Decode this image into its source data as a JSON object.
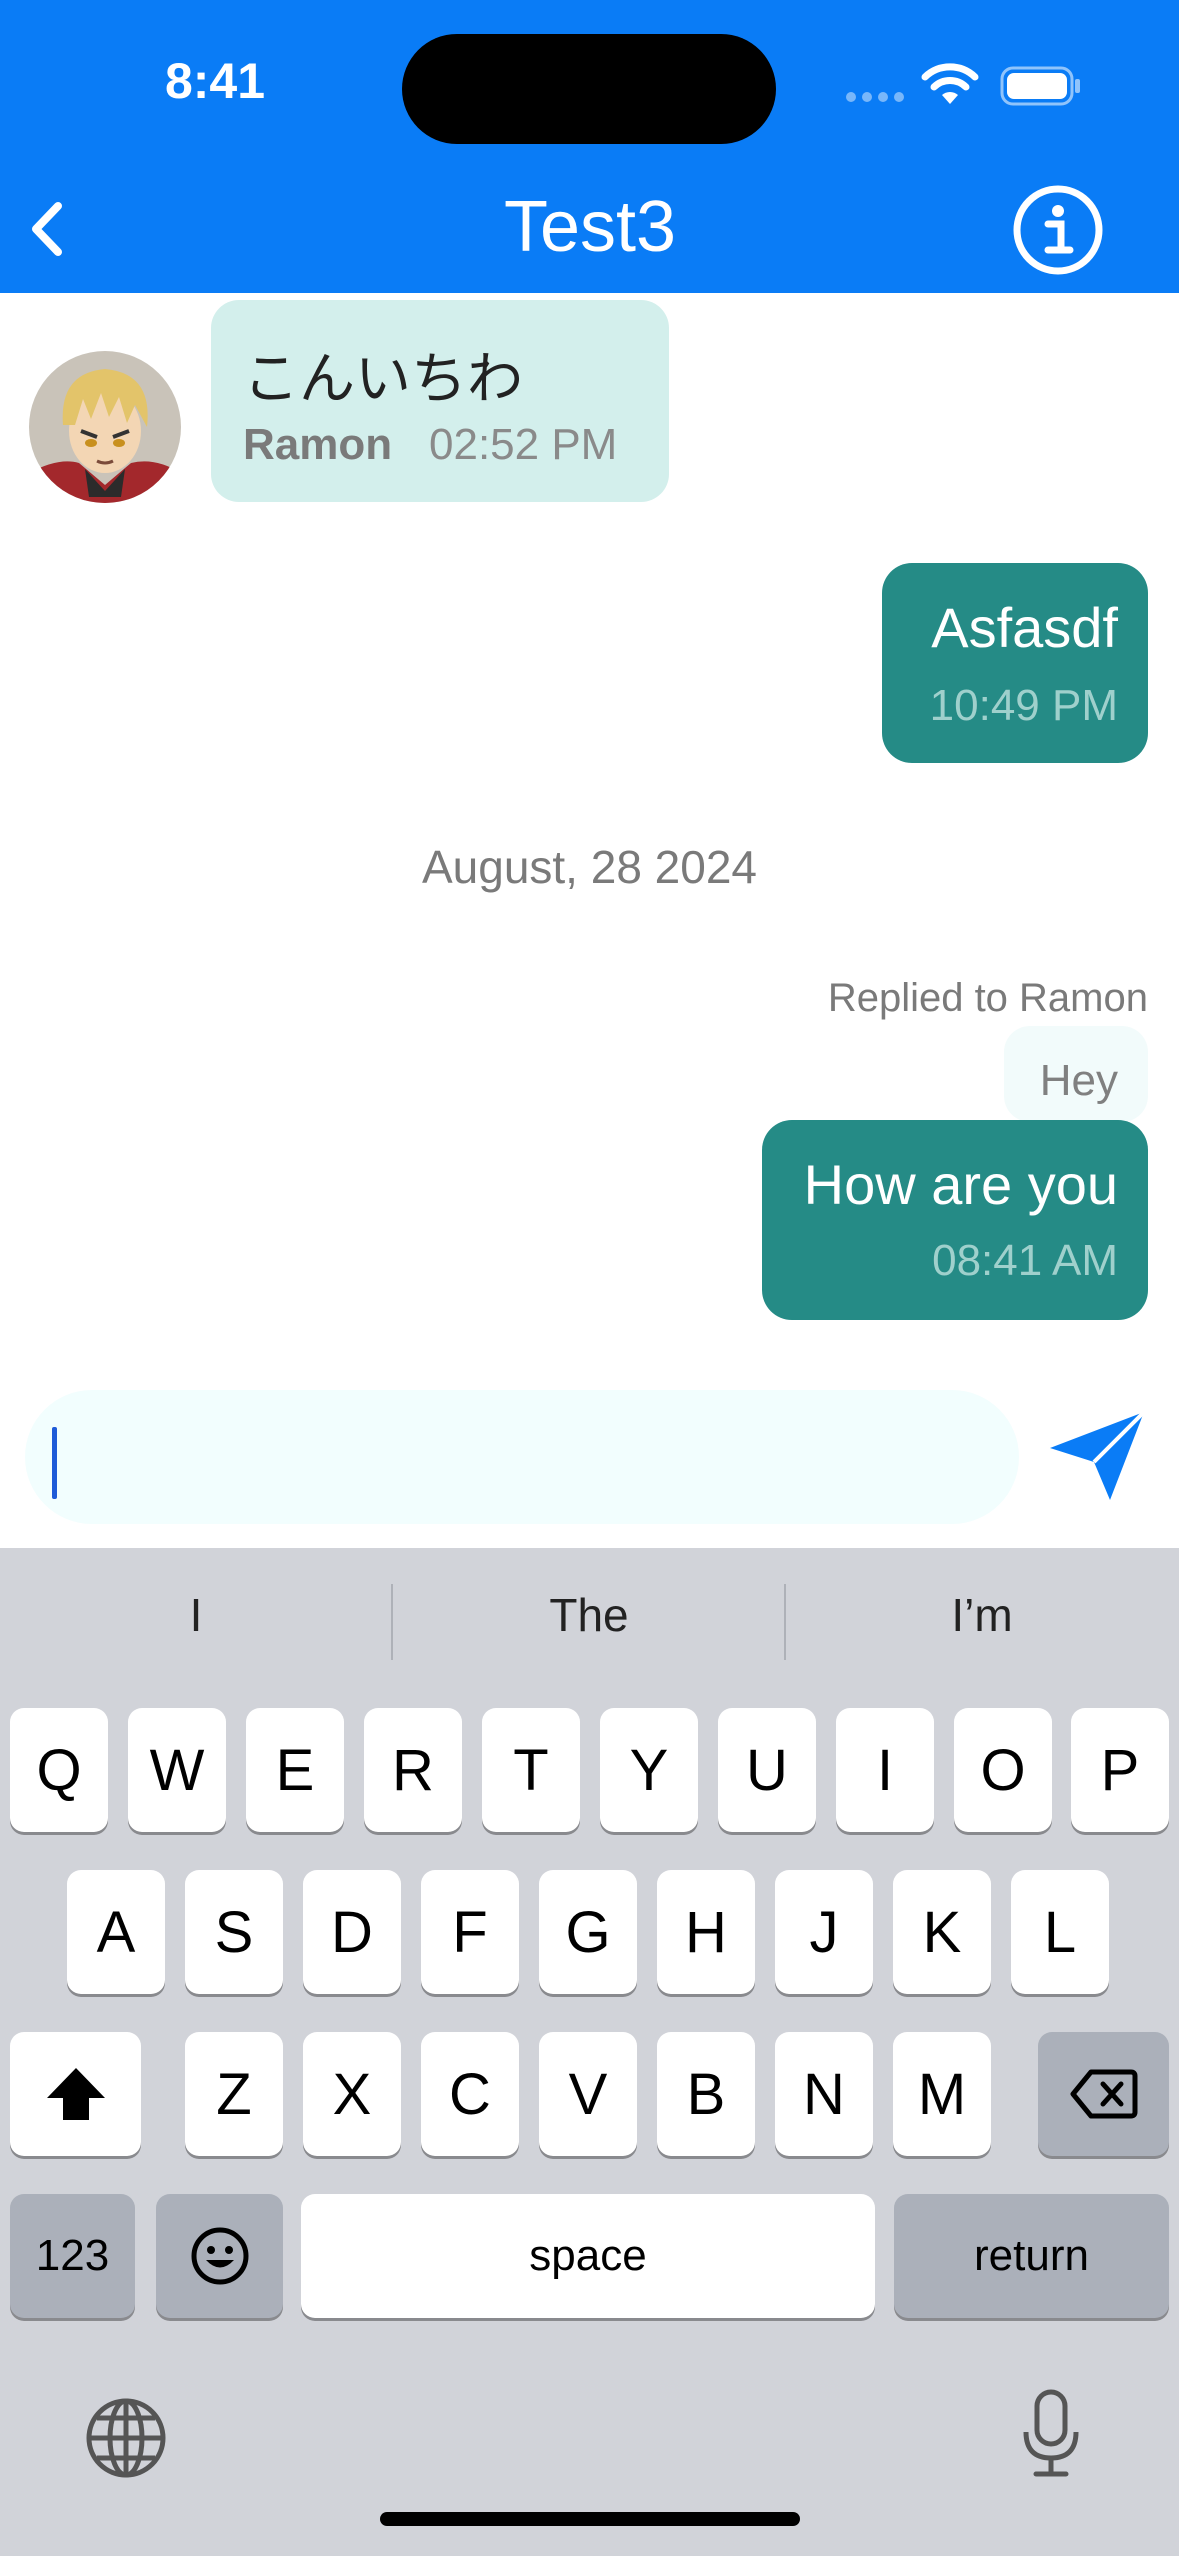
{
  "status_bar": {
    "time": "8:41"
  },
  "header": {
    "title": "Test3"
  },
  "messages": {
    "incoming": {
      "text": "こんいちわ",
      "sender": "Ramon",
      "time": "02:52 PM"
    },
    "outgoing_1": {
      "text": "Asfasdf",
      "time": "10:49 PM"
    },
    "date_separator": "August, 28 2024",
    "reply_label": "Replied to Ramon",
    "reply_quote": "Hey",
    "outgoing_2": {
      "text": "How are you",
      "time": "08:41 AM"
    }
  },
  "composer": {
    "value": "",
    "placeholder": ""
  },
  "keyboard": {
    "suggestions": [
      "I",
      "The",
      "I’m"
    ],
    "row1": [
      "Q",
      "W",
      "E",
      "R",
      "T",
      "Y",
      "U",
      "I",
      "O",
      "P"
    ],
    "row2": [
      "A",
      "S",
      "D",
      "F",
      "G",
      "H",
      "J",
      "K",
      "L"
    ],
    "row3": [
      "Z",
      "X",
      "C",
      "V",
      "B",
      "N",
      "M"
    ],
    "numbers_label": "123",
    "space_label": "space",
    "return_label": "return"
  },
  "colors": {
    "header_blue": "#0a7cf6",
    "outgoing_bubble": "#258b86",
    "incoming_bubble": "#d3efec",
    "keyboard_bg": "#d1d3d9"
  },
  "icons": [
    "back-chevron-icon",
    "info-icon",
    "send-icon",
    "wifi-icon",
    "battery-icon",
    "shift-icon",
    "backspace-icon",
    "emoji-icon",
    "globe-icon",
    "microphone-icon"
  ]
}
